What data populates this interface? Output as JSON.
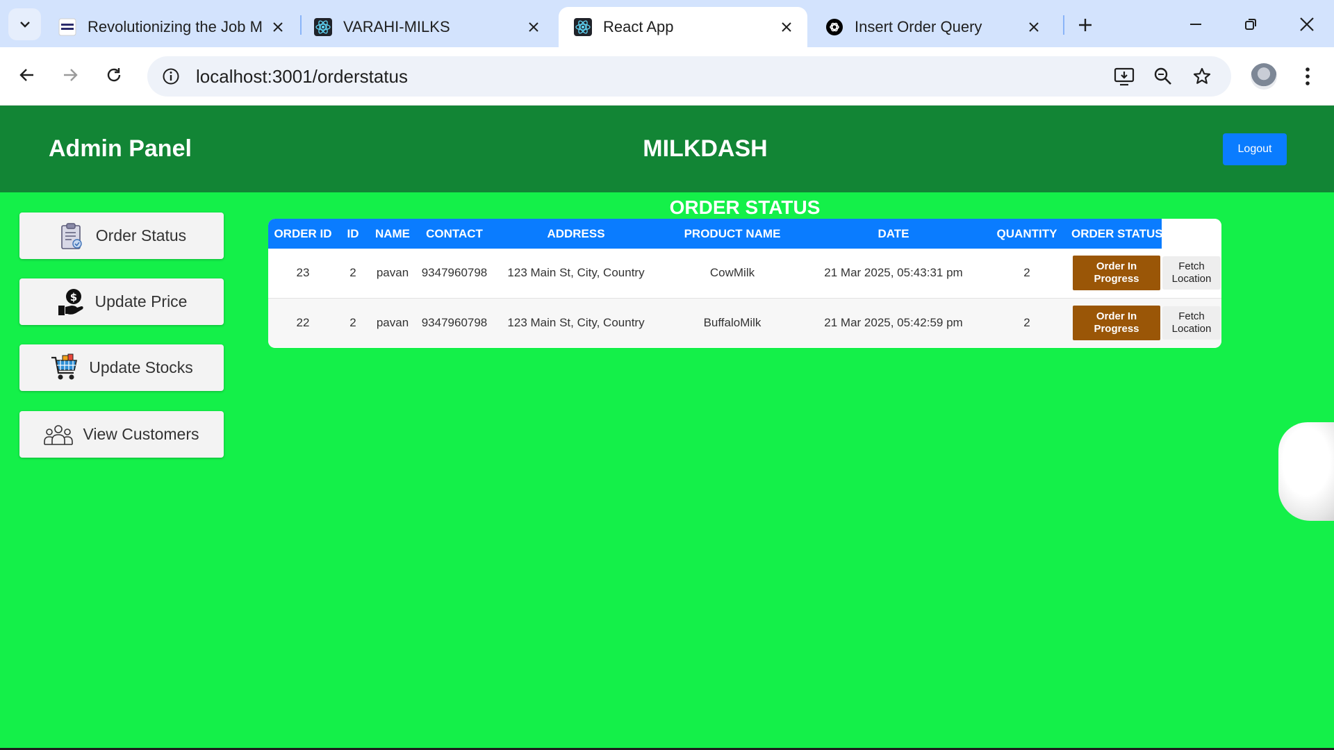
{
  "browser": {
    "tabs": [
      {
        "title": "Revolutionizing the Job M",
        "favicon": "nxtwave-icon",
        "active": false
      },
      {
        "title": "VARAHI-MILKS",
        "favicon": "react-icon",
        "active": false
      },
      {
        "title": "React App",
        "favicon": "react-icon",
        "active": true
      },
      {
        "title": "Insert Order Query",
        "favicon": "chatgpt-icon",
        "active": false
      }
    ],
    "url": "localhost:3001/orderstatus"
  },
  "header": {
    "admin_title": "Admin Panel",
    "brand": "MILKDASH",
    "logout_label": "Logout"
  },
  "sidebar": {
    "items": [
      {
        "label": "Order Status",
        "icon": "clipboard-icon"
      },
      {
        "label": "Update Price",
        "icon": "price-hand-icon"
      },
      {
        "label": "Update Stocks",
        "icon": "shopping-cart-icon"
      },
      {
        "label": "View Customers",
        "icon": "customers-icon"
      }
    ]
  },
  "main": {
    "heading": "ORDER STATUS",
    "columns": [
      "ORDER ID",
      "ID",
      "NAME",
      "CONTACT",
      "ADDRESS",
      "PRODUCT NAME",
      "DATE",
      "QUANTITY",
      "ORDER STATUS"
    ],
    "rows": [
      {
        "order_id": "23",
        "id": "2",
        "name": "pavan",
        "contact": "9347960798",
        "address": "123 Main St, City, Country",
        "product": "CowMilk",
        "date": "21 Mar 2025, 05:43:31 pm",
        "quantity": "2",
        "status_line1": "Order In",
        "status_line2": "Progress",
        "fetch_line1": "Fetch",
        "fetch_line2": "Location"
      },
      {
        "order_id": "22",
        "id": "2",
        "name": "pavan",
        "contact": "9347960798",
        "address": "123 Main St, City, Country",
        "product": "BuffaloMilk",
        "date": "21 Mar 2025, 05:42:59 pm",
        "quantity": "2",
        "status_line1": "Order In",
        "status_line2": "Progress",
        "fetch_line1": "Fetch",
        "fetch_line2": "Location"
      }
    ]
  },
  "colors": {
    "page_background": "#14f049",
    "header_background": "#128535",
    "table_header": "#0a7cff",
    "status_button": "#9a5607",
    "logout_button": "#0a7cff"
  }
}
